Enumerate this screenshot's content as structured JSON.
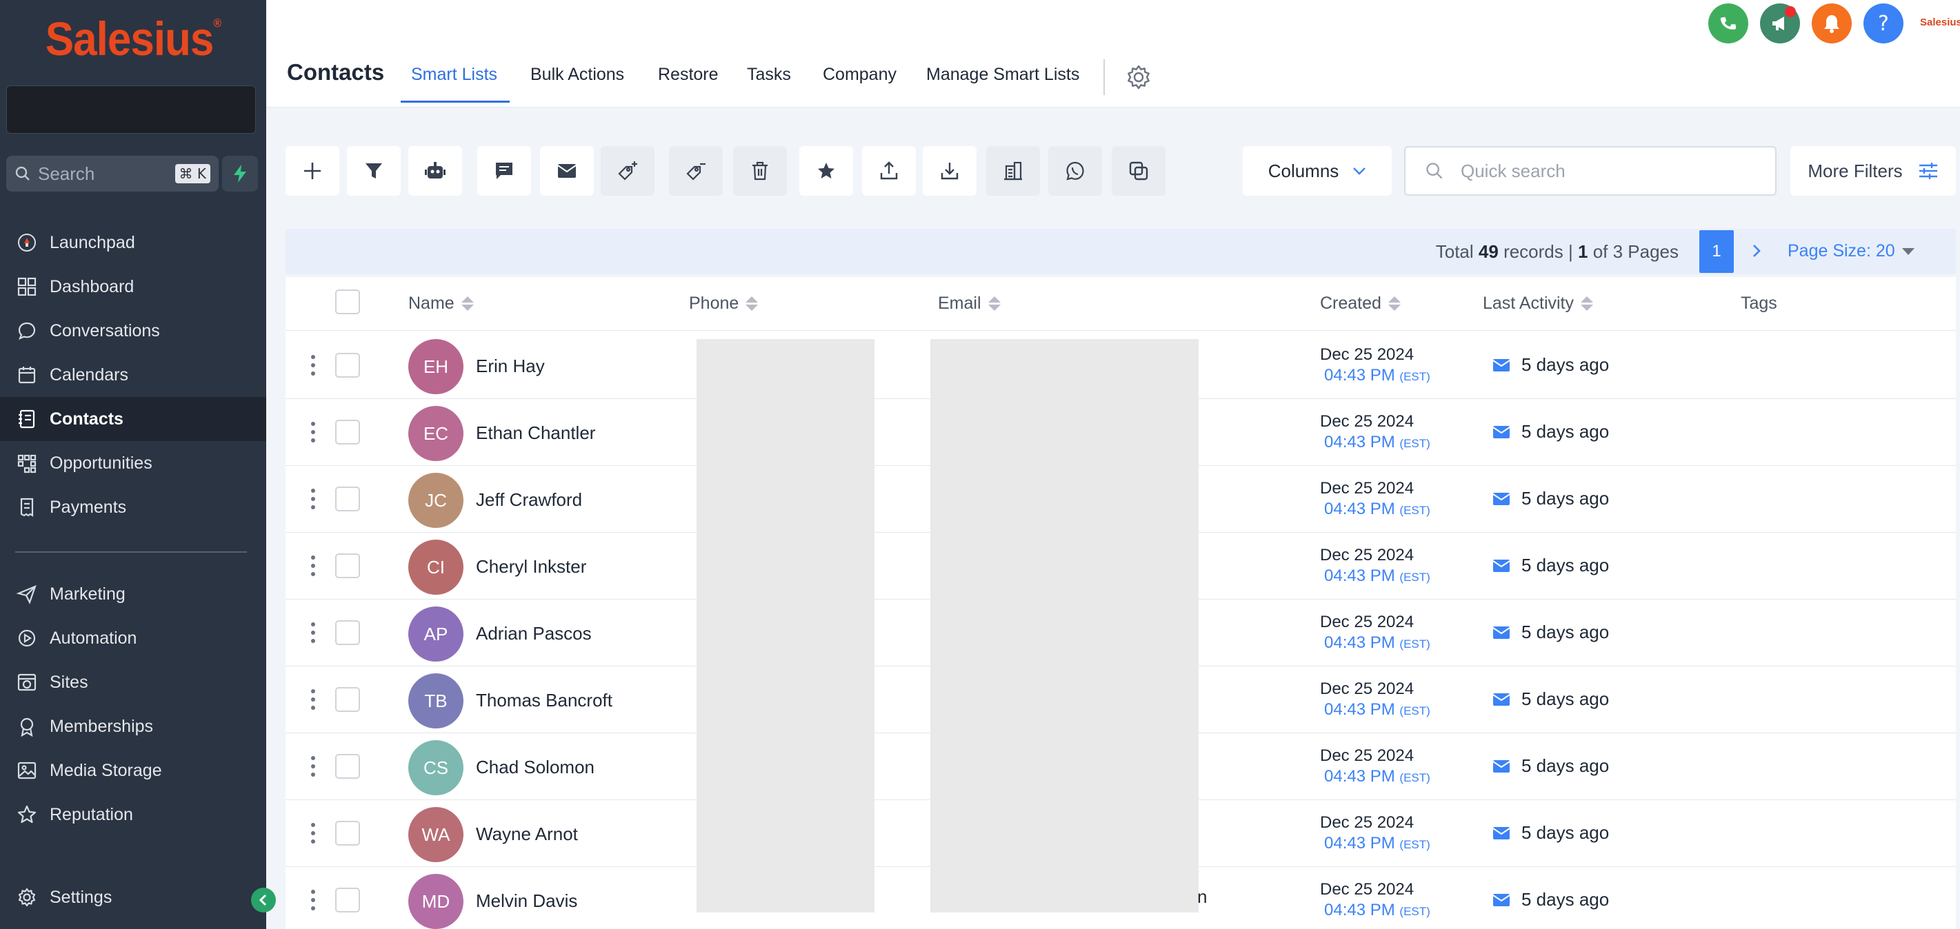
{
  "sidebar": {
    "logo": "Salesius",
    "search_placeholder": "Search",
    "search_shortcut": "⌘ K",
    "items": [
      {
        "label": "Launchpad",
        "icon": "rocket-icon"
      },
      {
        "label": "Dashboard",
        "icon": "grid-icon"
      },
      {
        "label": "Conversations",
        "icon": "chat-icon"
      },
      {
        "label": "Calendars",
        "icon": "calendar-icon"
      },
      {
        "label": "Contacts",
        "icon": "contact-book-icon",
        "active": true
      },
      {
        "label": "Opportunities",
        "icon": "pipeline-icon"
      },
      {
        "label": "Payments",
        "icon": "receipt-icon"
      },
      {
        "label": "Marketing",
        "icon": "send-icon"
      },
      {
        "label": "Automation",
        "icon": "automation-icon"
      },
      {
        "label": "Sites",
        "icon": "globe-icon"
      },
      {
        "label": "Memberships",
        "icon": "badge-icon"
      },
      {
        "label": "Media Storage",
        "icon": "image-icon"
      },
      {
        "label": "Reputation",
        "icon": "star-icon"
      },
      {
        "label": "Settings",
        "icon": "gear-icon"
      }
    ]
  },
  "header": {
    "title": "Contacts",
    "tabs": [
      {
        "label": "Smart Lists",
        "active": true
      },
      {
        "label": "Bulk Actions"
      },
      {
        "label": "Restore"
      },
      {
        "label": "Tasks"
      },
      {
        "label": "Company"
      },
      {
        "label": "Manage Smart Lists"
      }
    ],
    "brand_mini": "Salesius",
    "colors": {
      "phone": "#3fae5c",
      "announce": "#3e8a6a",
      "bell": "#f5701f",
      "help": "#3b82f6"
    }
  },
  "toolbar": {
    "columns_label": "Columns",
    "search_placeholder": "Quick search",
    "more_filters_label": "More Filters"
  },
  "pagination": {
    "total_prefix": "Total",
    "total_records": "49",
    "records_word": "records |",
    "current_page": "1",
    "pages_text": "of 3 Pages",
    "page_button": "1",
    "page_size": "Page Size: 20"
  },
  "table": {
    "columns": [
      "Name",
      "Phone",
      "Email",
      "Created",
      "Last Activity",
      "Tags"
    ],
    "rows": [
      {
        "initials": "EH",
        "name": "Erin Hay",
        "color": "#b9668f",
        "date": "Dec 25 2024",
        "time": "04:43 PM",
        "tz": "(EST)",
        "activity": "5 days ago"
      },
      {
        "initials": "EC",
        "name": "Ethan Chantler",
        "color": "#b96b93",
        "date": "Dec 25 2024",
        "time": "04:43 PM",
        "tz": "(EST)",
        "activity": "5 days ago"
      },
      {
        "initials": "JC",
        "name": "Jeff Crawford",
        "color": "#b99074",
        "date": "Dec 25 2024",
        "time": "04:43 PM",
        "tz": "(EST)",
        "activity": "5 days ago"
      },
      {
        "initials": "CI",
        "name": "Cheryl Inkster",
        "color": "#b86b6b",
        "date": "Dec 25 2024",
        "time": "04:43 PM",
        "tz": "(EST)",
        "activity": "5 days ago"
      },
      {
        "initials": "AP",
        "name": "Adrian Pascos",
        "color": "#8c70bb",
        "date": "Dec 25 2024",
        "time": "04:43 PM",
        "tz": "(EST)",
        "activity": "5 days ago"
      },
      {
        "initials": "TB",
        "name": "Thomas Bancroft",
        "color": "#7c7db8",
        "date": "Dec 25 2024",
        "time": "04:43 PM",
        "tz": "(EST)",
        "activity": "5 days ago"
      },
      {
        "initials": "CS",
        "name": "Chad Solomon",
        "color": "#7db9b0",
        "date": "Dec 25 2024",
        "time": "04:43 PM",
        "tz": "(EST)",
        "activity": "5 days ago"
      },
      {
        "initials": "WA",
        "name": "Wayne Arnot",
        "color": "#b86e74",
        "date": "Dec 25 2024",
        "time": "04:43 PM",
        "tz": "(EST)",
        "activity": "5 days ago"
      },
      {
        "initials": "MD",
        "name": "Melvin Davis",
        "color": "#b46ea5",
        "date": "Dec 25 2024",
        "time": "04:43 PM",
        "tz": "(EST)",
        "activity": "5 days ago"
      }
    ],
    "email_fragment": "n"
  }
}
